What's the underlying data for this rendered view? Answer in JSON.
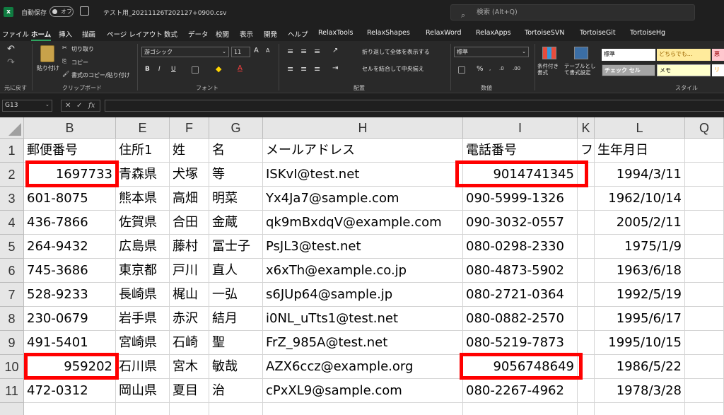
{
  "titlebar": {
    "logo": "x",
    "autosave_label": "自動保存",
    "autosave_state": "オフ",
    "filename": "テスト用_20211126T202127+0900.csv",
    "search_placeholder": "検索 (Alt+Q)"
  },
  "menu": [
    "ファイル",
    "ホーム",
    "挿入",
    "描画",
    "ページ レイアウト",
    "数式",
    "データ",
    "校閲",
    "表示",
    "開発",
    "ヘルプ",
    "RelaxTools",
    "RelaxShapes",
    "RelaxWord",
    "RelaxApps",
    "TortoiseSVN",
    "TortoiseGit",
    "TortoiseHg"
  ],
  "ribbon": {
    "undo_group": "元に戻す",
    "clipboard": {
      "paste": "貼り付け",
      "cut": "切り取り",
      "copy": "コピー",
      "format_painter": "書式のコピー/貼り付け",
      "label": "クリップボード"
    },
    "font": {
      "name": "游ゴシック",
      "size": "11",
      "grow": "A",
      "shrink": "A",
      "bold": "B",
      "italic": "I",
      "underline": "U",
      "font_color": "A",
      "label": "フォント"
    },
    "alignment": {
      "wrap": "折り返して全体を表示する",
      "merge": "セルを結合して中央揃え",
      "label": "配置"
    },
    "number": {
      "format": "標準",
      "percent": "%",
      "label": "数値"
    },
    "styles": {
      "conditional": "条件付き書式",
      "table": "テーブルとして書式設定",
      "label": "スタイル",
      "cells": [
        {
          "text": "標準",
          "bg": "#ffffff",
          "fg": "#000000"
        },
        {
          "text": "どちらでも...",
          "bg": "#ffeb9c",
          "fg": "#9c6500"
        },
        {
          "text": "悪",
          "bg": "#ffc7ce",
          "fg": "#9c0006"
        },
        {
          "text": "チェック セル",
          "bg": "#a5a5a5",
          "fg": "#ffffff"
        },
        {
          "text": "メモ",
          "bg": "#ffffcc",
          "fg": "#000000"
        },
        {
          "text": "リ",
          "bg": "#ffffff",
          "fg": "#ff9900"
        }
      ]
    }
  },
  "formula_bar": {
    "name_box": "G13",
    "fx": "fx",
    "value": ""
  },
  "sheet": {
    "columns": [
      "B",
      "E",
      "F",
      "G",
      "H",
      "I",
      "K",
      "L",
      "Q"
    ],
    "rows": [
      "1",
      "2",
      "3",
      "4",
      "5",
      "6",
      "7",
      "8",
      "9",
      "10",
      "11"
    ],
    "data": [
      [
        "郵便番号",
        "住所1",
        "姓",
        "名",
        "メールアドレス",
        "電話番号",
        "フ",
        "生年月日"
      ],
      [
        "1697733",
        "青森県",
        "犬塚",
        "等",
        "ISKvI@test.net",
        "9014741345",
        "",
        "1994/3/11"
      ],
      [
        "601-8075",
        "熊本県",
        "高畑",
        "明菜",
        "Yx4Ja7@sample.com",
        "090-5999-1326",
        "",
        "1962/10/14"
      ],
      [
        "436-7866",
        "佐賀県",
        "合田",
        "金蔵",
        "qk9mBxdqV@example.com",
        "090-3032-0557",
        "",
        "2005/2/11"
      ],
      [
        "264-9432",
        "広島県",
        "藤村",
        "冨士子",
        "PsJL3@test.net",
        "080-0298-2330",
        "",
        "1975/1/9"
      ],
      [
        "745-3686",
        "東京都",
        "戸川",
        "直人",
        "x6xTh@example.co.jp",
        "080-4873-5902",
        "",
        "1963/6/18"
      ],
      [
        "528-9233",
        "長崎県",
        "梶山",
        "一弘",
        "s6JUp64@sample.jp",
        "080-2721-0364",
        "",
        "1992/5/19"
      ],
      [
        "230-0679",
        "岩手県",
        "赤沢",
        "結月",
        "i0NL_uTts1@test.net",
        "080-0882-2570",
        "",
        "1995/6/17"
      ],
      [
        "491-5401",
        "宮崎県",
        "石崎",
        "聖",
        "FrZ_985A@test.net",
        "080-5219-7873",
        "",
        "1995/10/15"
      ],
      [
        "959202",
        "石川県",
        "宮木",
        "敏哉",
        "AZX6ccz@example.org",
        "9056748649",
        "",
        "1986/5/22"
      ],
      [
        "472-0312",
        "岡山県",
        "夏目",
        "治",
        "cPxXL9@sample.com",
        "080-2267-4962",
        "",
        "1978/3/28"
      ]
    ]
  },
  "colors": {
    "highlight": "#ff0000",
    "accent": "#107c41"
  }
}
